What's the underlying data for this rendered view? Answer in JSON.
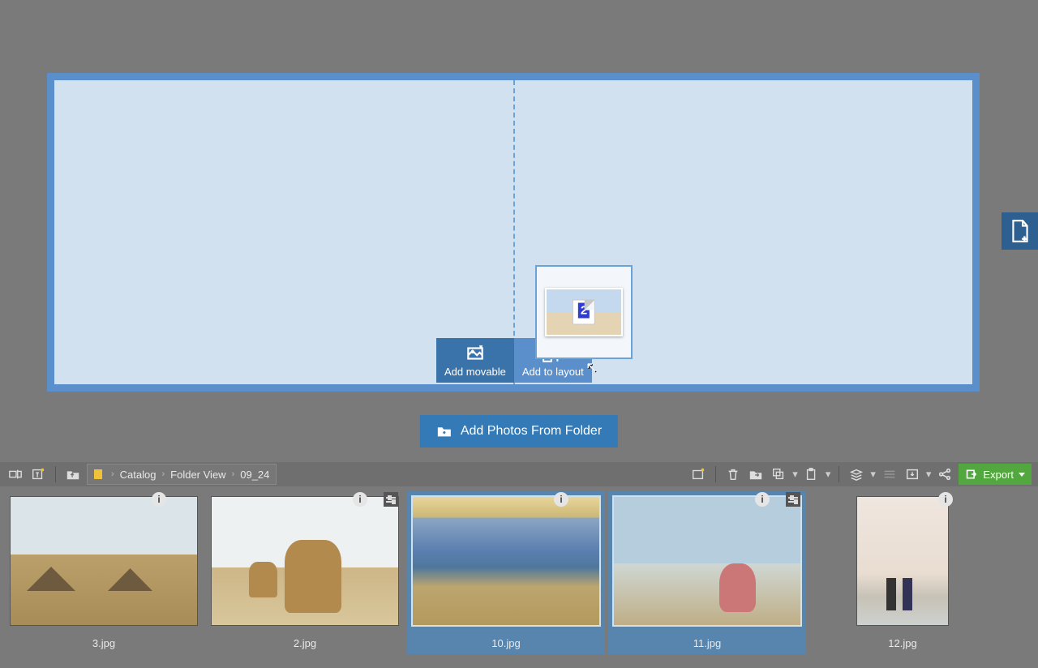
{
  "spread": {
    "drop_actions": {
      "add_movable": "Add movable",
      "add_to_layout": "Add to layout"
    },
    "drag_preview_count": "2"
  },
  "add_photos_button": "Add Photos From Folder",
  "breadcrumb": [
    "Catalog",
    "Folder View",
    "09_24"
  ],
  "export_label": "Export",
  "thumbnails": [
    {
      "filename": "3.jpg",
      "selected": false,
      "portrait": false,
      "scene": "sc-umbrella"
    },
    {
      "filename": "2.jpg",
      "selected": false,
      "portrait": false,
      "scene": "sc-camel"
    },
    {
      "filename": "10.jpg",
      "selected": true,
      "portrait": false,
      "scene": "sc-shore"
    },
    {
      "filename": "11.jpg",
      "selected": true,
      "portrait": false,
      "scene": "sc-child"
    },
    {
      "filename": "12.jpg",
      "selected": false,
      "portrait": true,
      "scene": "sc-couple"
    }
  ]
}
